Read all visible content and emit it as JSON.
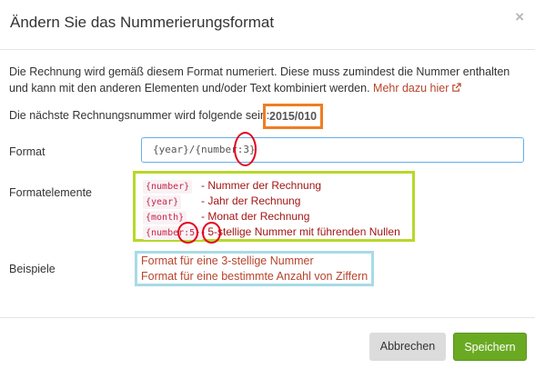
{
  "dialog": {
    "title": "Ändern Sie das Nummerierungsformat",
    "close_label": "×"
  },
  "intro": {
    "text": "Die Rechnung wird gemäß diesem Format numeriert. Diese muss zumindest die Nummer enthalten und kann mit den anderen Elementen und/oder Text kombiniert werden. ",
    "link": "Mehr dazu hier"
  },
  "next_number": {
    "label": "Die nächste Rechnungsnummer wird folgende sein:",
    "value": "2015/010"
  },
  "format": {
    "label": "Format",
    "value": "{year}/{number:3}"
  },
  "elements": {
    "label": "Formatelemente",
    "items": [
      {
        "code": "{number}",
        "desc": "- Nummer der Rechnung"
      },
      {
        "code": "{year}",
        "desc": "- Jahr der Rechnung"
      },
      {
        "code": "{month}",
        "desc": "- Monat der Rechnung"
      },
      {
        "code": "{number:5}",
        "desc": "- 5-stellige Nummer mit führenden Nullen"
      }
    ]
  },
  "examples": {
    "label": "Beispiele",
    "items": [
      "Format für eine 3-stellige Nummer",
      "Format für eine bestimmte Anzahl von Ziffern"
    ]
  },
  "buttons": {
    "cancel": "Abbrechen",
    "save": "Speichern"
  },
  "colors": {
    "accent_link": "#b8432c",
    "save_button": "#6aaa23",
    "highlight_orange": "#ef7d22",
    "highlight_green": "#b8d829",
    "highlight_blue": "#a8dbe6",
    "annotation_red": "#e3001b"
  }
}
